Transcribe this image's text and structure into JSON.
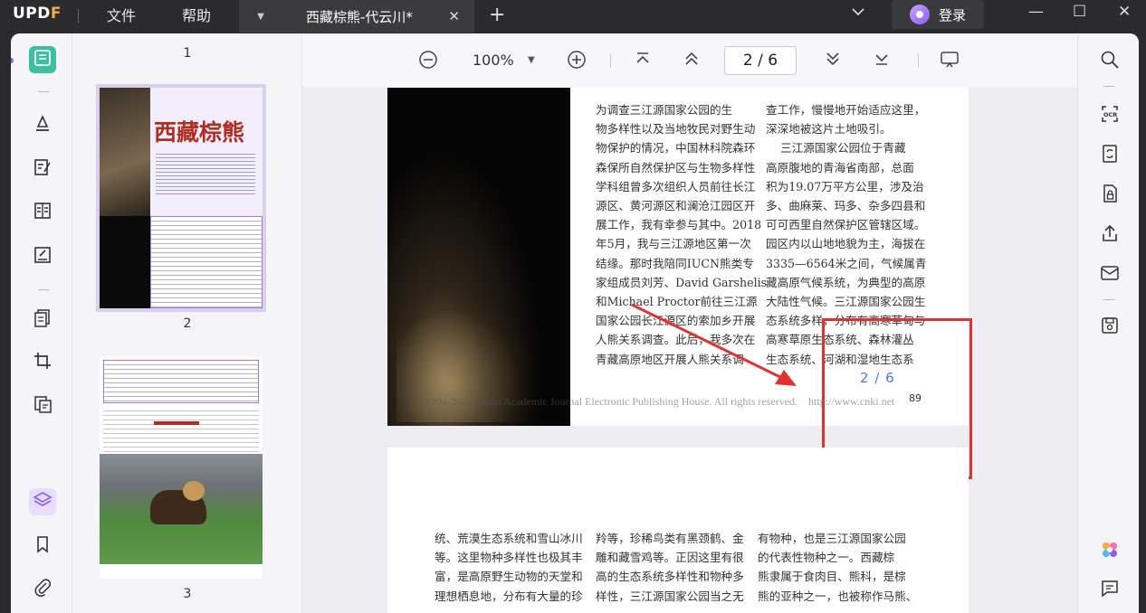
{
  "titlebar": {
    "logo_a": "UPD",
    "logo_b": "F",
    "menu_file": "文件",
    "menu_help": "帮助",
    "tab_title": "西藏棕熊-代云川*",
    "login": "登录"
  },
  "toolbar": {
    "zoom": "100%",
    "page_indicator": "2  /  6"
  },
  "thumbnails": {
    "page1": "1",
    "page2": "2",
    "page3": "3",
    "page2_heading": "西藏棕熊"
  },
  "document": {
    "page2_col1": "为调查三江源国家公园的生\n物多样性以及当地牧民对野生动\n物保护的情况，中国林科院森环\n森保所自然保护区与生物多样性\n学科组曾多次组织人员前往长江\n源区、黄河源区和澜沧江园区开\n展工作，我有幸参与其中。2018\n年5月，我与三江源地区第一次\n结缘。那时我陪同IUCN熊类专\n家组成员刘芳、David Garshelis\n和Michael Proctor前往三江源\n国家公园长江源区的索加乡开展\n人熊关系调查。此后，我多次在\n青藏高原地区开展人熊关系调",
    "page2_col2": "查工作，慢慢地开始适应这里，\n深深地被这片土地吸引。\n    三江源国家公园位于青藏\n高原腹地的青海省南部，总面\n积为19.07万平方公里，涉及治\n多、曲麻莱、玛多、杂多四县和\n可可西里自然保护区管辖区域。\n园区内以山地地貌为主，海拔在\n3335—6564米之间，气候属青\n藏高原气候系统，为典型的高原\n大陆性气候。三江源国家公园生\n态系统多样，分布有高寒草甸与\n高寒草原生态系统、森林灌丛\n生态系统、河湖和湿地生态系",
    "watermark": "© 1994-2022 China Academic Journal Electronic Publishing House. All rights reserved.    http://www.cnki.net",
    "page_label": "2 / 6",
    "page_number": "89",
    "page3_col1": "统、荒漠生态系统和雪山冰川\n等。这里物种多样性也极其丰\n富，是高原野生动物的天堂和\n理想栖息地，分布有大量的珍",
    "page3_col2": "羚等，珍稀鸟类有黑颈鹤、金\n雕和藏雪鸡等。正因这里有很\n高的生态系统多样性和物种多\n样性，三江源国家公园当之无",
    "page3_col3": "有物种，也是三江源国家公园\n的代表性物种之一。西藏棕\n熊隶属于食肉目、熊科，是棕\n熊的亚种之一，也被称作马熊、"
  },
  "colors": {
    "accent": "#8f5df2",
    "annotation": "#e53030",
    "page_label": "#4a7cf0"
  }
}
